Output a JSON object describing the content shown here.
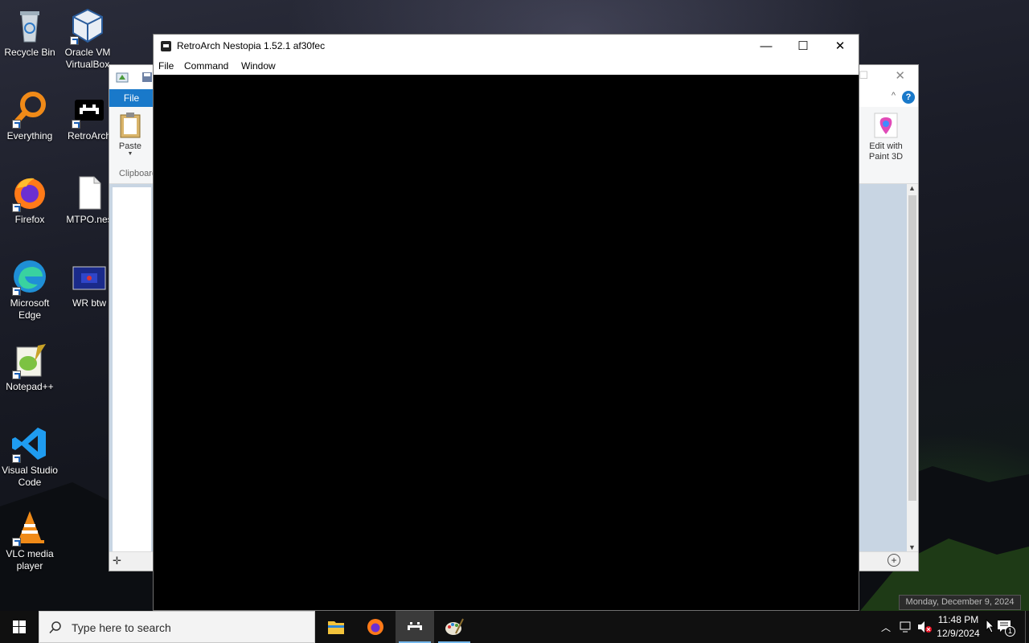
{
  "desktop": {
    "icons": [
      {
        "label": "Recycle Bin",
        "icon": "recycle-bin-icon"
      },
      {
        "label": "Oracle VM VirtualBox",
        "icon": "virtualbox-icon"
      },
      {
        "label": "Everything",
        "icon": "everything-search-icon"
      },
      {
        "label": "RetroArch",
        "icon": "retroarch-icon"
      },
      {
        "label": "Firefox",
        "icon": "firefox-icon"
      },
      {
        "label": "MTPO.nes",
        "icon": "file-icon"
      },
      {
        "label": "Microsoft Edge",
        "icon": "edge-icon"
      },
      {
        "label": "WR btw",
        "icon": "video-thumbnail-icon"
      },
      {
        "label": "Notepad++",
        "icon": "notepadpp-icon"
      },
      {
        "label": "Visual Studio Code",
        "icon": "vscode-icon"
      },
      {
        "label": "VLC media player",
        "icon": "vlc-icon"
      }
    ]
  },
  "paint": {
    "file_tab": "File",
    "paste_label": "Paste",
    "clipboard_label": "Clipboard",
    "edit_with_paint3d": "Edit with Paint 3D",
    "accent": "#1979ca"
  },
  "retroarch": {
    "title": "RetroArch Nestopia 1.52.1 af30fec",
    "menu": [
      "File",
      "Command",
      "Window"
    ],
    "minimize": "—",
    "maximize": "☐",
    "close": "✕"
  },
  "taskbar": {
    "search_placeholder": "Type here to search",
    "apps": [
      "file-explorer-icon",
      "firefox-icon",
      "retroarch-icon",
      "paint-icon"
    ],
    "active_app": "retroarch-icon",
    "time": "11:48 PM",
    "date": "12/9/2024",
    "date_tooltip": "Monday, December 9, 2024",
    "notification_count": "1"
  }
}
